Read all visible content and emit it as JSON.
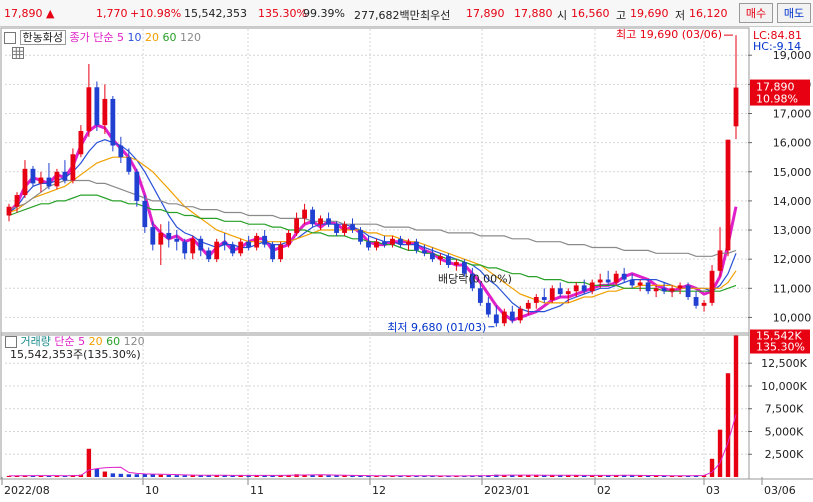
{
  "topbar": {
    "price": "17,890",
    "change_arrow": "▲",
    "change": "1,770",
    "change_pct": "+10.98%",
    "volume": "15,542,353",
    "volume_ratio": "135.30%",
    "strength": "99.39%",
    "trade_value": "277,682백만",
    "best_quote_label": "최우선",
    "best_ask": "17,890",
    "best_bid": "17,880",
    "open_label": "시",
    "open": "16,560",
    "high_label": "고",
    "high": "19,690",
    "low_label": "저",
    "low": "16,120",
    "buy_label": "매수",
    "sell_label": "매도"
  },
  "price_panel": {
    "stock_name": "한농화성",
    "ma_label": "종가 단순",
    "ma_periods": [
      "5",
      "10",
      "20",
      "60",
      "120"
    ],
    "ma_colors": [
      "#e020c8",
      "#2850d8",
      "#f0a000",
      "#28a028",
      "#8a8a8a"
    ],
    "high_annotation": "최고 19,690 (03/06)",
    "low_annotation": "최저 9,680 (01/03)",
    "mid_annotation": "배당락(0.00%)",
    "lc_label": "LC:84.81",
    "hc_label": "HC:-9.14",
    "current_price_tag": "17,890",
    "current_pct_tag": "10.98%",
    "y_ticks": [
      "19,000",
      "18,000",
      "17,000",
      "16,000",
      "15,000",
      "14,000",
      "13,000",
      "12,000",
      "11,000",
      "10,000"
    ]
  },
  "volume_panel": {
    "label": "거래량",
    "ma_label": "단순",
    "ma_periods": [
      "5",
      "20",
      "60",
      "120"
    ],
    "ma_colors": [
      "#e020c8",
      "#f0a000",
      "#28a028",
      "#8a8a8a"
    ],
    "volume_text": "15,542,353주(135.30%)",
    "current_volume_tag": "15,542K",
    "current_ratio_tag": "135.30%",
    "y_ticks": [
      "12,500K",
      "10,000K",
      "7,500K",
      "5,000K",
      "2,500K"
    ]
  },
  "x_axis": {
    "labels": [
      "2022/08",
      "10",
      "11",
      "12",
      "2023/01",
      "02",
      "03",
      "03/06"
    ]
  },
  "chart_data": {
    "type": "candlestick",
    "price_ylim": [
      9500,
      19900
    ],
    "volume_ylim": [
      0,
      15600
    ],
    "annotations": [
      {
        "text": "최고 19,690 (03/06)",
        "value": 19690
      },
      {
        "text": "최저 9,680 (01/03)",
        "value": 9680
      },
      {
        "text": "배당락(0.00%)",
        "value": 11200
      }
    ],
    "series": [
      {
        "name": "5",
        "values": [
          13600,
          13900,
          14500,
          14800,
          14700,
          14600,
          14900,
          14800,
          15200,
          15900,
          16400,
          16600,
          16500,
          16100,
          15800,
          15500,
          15000,
          14200,
          13200,
          12900,
          12700,
          12800,
          12600,
          12700,
          12400,
          12100,
          12400,
          12600,
          12300,
          12400,
          12600,
          12700,
          12700,
          12300,
          12400,
          12500,
          12900,
          13200,
          13300,
          13100,
          13300,
          13200,
          13000,
          13100,
          12900,
          12600,
          12500,
          12500,
          12600,
          12600,
          12600,
          12500,
          12300,
          12200,
          12000,
          11900,
          11800,
          11800,
          11500,
          11200,
          10800,
          10400,
          10100,
          9900,
          10000,
          10100,
          10200,
          10400,
          10600,
          10700,
          10700,
          10800,
          10900,
          11000,
          11100,
          11100,
          11200,
          11400,
          11500,
          11400,
          11300,
          11100,
          11000,
          10900,
          11000,
          11100,
          11000,
          10800,
          10900,
          11400,
          12500,
          13800
        ]
      },
      {
        "name": "10",
        "values": [
          13600,
          13800,
          14200,
          14500,
          14600,
          14600,
          14700,
          14800,
          15000,
          15300,
          15700,
          16000,
          16100,
          16000,
          15900,
          15700,
          15400,
          15000,
          14500,
          14000,
          13500,
          13100,
          12900,
          12800,
          12600,
          12500,
          12400,
          12500,
          12500,
          12400,
          12400,
          12500,
          12600,
          12500,
          12500,
          12600,
          12700,
          12900,
          13100,
          13200,
          13200,
          13200,
          13200,
          13100,
          13000,
          12800,
          12700,
          12600,
          12600,
          12500,
          12500,
          12500,
          12400,
          12300,
          12200,
          12100,
          12000,
          11900,
          11800,
          11600,
          11300,
          11100,
          10800,
          10500,
          10300,
          10200,
          10200,
          10200,
          10300,
          10400,
          10600,
          10700,
          10800,
          10900,
          11000,
          11000,
          11100,
          11200,
          11300,
          11300,
          11300,
          11300,
          11200,
          11100,
          11000,
          11000,
          11000,
          11000,
          10900,
          11100,
          11500,
          12200
        ]
      },
      {
        "name": "20",
        "values": [
          13600,
          13700,
          13900,
          14100,
          14200,
          14300,
          14400,
          14500,
          14700,
          14900,
          15100,
          15300,
          15400,
          15500,
          15500,
          15500,
          15400,
          15200,
          15000,
          14700,
          14400,
          14100,
          13800,
          13600,
          13400,
          13200,
          13000,
          12900,
          12800,
          12700,
          12600,
          12600,
          12600,
          12600,
          12600,
          12600,
          12700,
          12800,
          12900,
          13000,
          13000,
          13000,
          13000,
          13000,
          13000,
          12900,
          12900,
          12800,
          12800,
          12700,
          12600,
          12600,
          12500,
          12400,
          12300,
          12200,
          12100,
          12000,
          11900,
          11800,
          11600,
          11400,
          11200,
          11000,
          10800,
          10700,
          10600,
          10500,
          10500,
          10500,
          10500,
          10600,
          10700,
          10700,
          10800,
          10900,
          10900,
          11000,
          11000,
          11100,
          11100,
          11100,
          11100,
          11100,
          11000,
          11000,
          11000,
          11000,
          11000,
          11000,
          11200,
          11600
        ]
      },
      {
        "name": "60",
        "values": [
          13500,
          13600,
          13700,
          13800,
          13900,
          13900,
          14000,
          14000,
          14100,
          14200,
          14200,
          14200,
          14100,
          14000,
          14000,
          13900,
          13900,
          13800,
          13700,
          13700,
          13600,
          13600,
          13500,
          13500,
          13400,
          13400,
          13400,
          13300,
          13300,
          13300,
          13200,
          13200,
          13200,
          13100,
          13100,
          13000,
          13000,
          13000,
          12900,
          12900,
          12800,
          12800,
          12800,
          12700,
          12700,
          12600,
          12600,
          12500,
          12500,
          12400,
          12300,
          12300,
          12200,
          12200,
          12100,
          12000,
          12000,
          11900,
          11800,
          11800,
          11700,
          11700,
          11600,
          11500,
          11500,
          11400,
          11400,
          11300,
          11300,
          11300,
          11200,
          11200,
          11200,
          11100,
          11100,
          11100,
          11100,
          11000,
          11000,
          11000,
          11000,
          11000,
          10900,
          10900,
          10900,
          10900,
          10900,
          10900,
          10900,
          10900,
          11000,
          11100
        ]
      },
      {
        "name": "120",
        "values": [
          13700,
          13800,
          13900,
          14100,
          14300,
          14500,
          14600,
          14700,
          14700,
          14700,
          14700,
          14600,
          14600,
          14500,
          14400,
          14300,
          14200,
          14100,
          14000,
          14000,
          13900,
          13900,
          13800,
          13800,
          13700,
          13700,
          13700,
          13600,
          13600,
          13600,
          13500,
          13500,
          13500,
          13500,
          13400,
          13400,
          13400,
          13400,
          13300,
          13300,
          13300,
          13300,
          13200,
          13200,
          13200,
          13200,
          13200,
          13100,
          13100,
          13100,
          13100,
          13000,
          13000,
          13000,
          13000,
          12900,
          12900,
          12900,
          12900,
          12800,
          12800,
          12800,
          12800,
          12700,
          12700,
          12700,
          12600,
          12600,
          12600,
          12600,
          12500,
          12500,
          12500,
          12400,
          12400,
          12400,
          12400,
          12300,
          12300,
          12300,
          12300,
          12200,
          12200,
          12200,
          12200,
          12200,
          12100,
          12100,
          12100,
          12200,
          12200,
          12300
        ]
      }
    ],
    "candles": [
      [
        13500,
        13900,
        13300,
        13800
      ],
      [
        13800,
        14300,
        13600,
        14200
      ],
      [
        14200,
        15400,
        14100,
        15100
      ],
      [
        15100,
        15200,
        14500,
        14600
      ],
      [
        14600,
        15000,
        14300,
        14800
      ],
      [
        14800,
        15300,
        14400,
        14500
      ],
      [
        14500,
        15100,
        14400,
        15000
      ],
      [
        15000,
        15400,
        14600,
        14700
      ],
      [
        14700,
        15800,
        14600,
        15600
      ],
      [
        15600,
        16600,
        15500,
        16400
      ],
      [
        16400,
        18700,
        16200,
        17900
      ],
      [
        17900,
        18100,
        16400,
        16600
      ],
      [
        16600,
        18000,
        16300,
        17500
      ],
      [
        17500,
        17600,
        15700,
        15900
      ],
      [
        15900,
        16200,
        15300,
        15500
      ],
      [
        15500,
        15800,
        14900,
        15000
      ],
      [
        15000,
        15100,
        13800,
        14000
      ],
      [
        14000,
        14200,
        12900,
        13100
      ],
      [
        13100,
        13300,
        12300,
        12500
      ],
      [
        12500,
        13200,
        11800,
        12900
      ],
      [
        12900,
        13300,
        12400,
        12700
      ],
      [
        12700,
        13000,
        12300,
        12600
      ],
      [
        12600,
        12700,
        12000,
        12200
      ],
      [
        12200,
        12800,
        12000,
        12700
      ],
      [
        12700,
        12800,
        12100,
        12300
      ],
      [
        12300,
        12400,
        11900,
        12000
      ],
      [
        12000,
        12700,
        11900,
        12600
      ],
      [
        12600,
        12900,
        12300,
        12500
      ],
      [
        12500,
        12600,
        12100,
        12200
      ],
      [
        12200,
        12700,
        12100,
        12600
      ],
      [
        12600,
        12800,
        12300,
        12400
      ],
      [
        12400,
        12900,
        12300,
        12800
      ],
      [
        12800,
        13000,
        12400,
        12500
      ],
      [
        12500,
        12600,
        11900,
        12000
      ],
      [
        12000,
        12600,
        11900,
        12500
      ],
      [
        12500,
        13000,
        12400,
        12900
      ],
      [
        12900,
        13600,
        12800,
        13400
      ],
      [
        13400,
        13900,
        13200,
        13700
      ],
      [
        13700,
        13800,
        13100,
        13200
      ],
      [
        13200,
        13500,
        13000,
        13400
      ],
      [
        13400,
        13600,
        13100,
        13200
      ],
      [
        13200,
        13300,
        12800,
        12900
      ],
      [
        12900,
        13300,
        12800,
        13200
      ],
      [
        13200,
        13400,
        12900,
        13000
      ],
      [
        13000,
        13100,
        12500,
        12600
      ],
      [
        12600,
        12800,
        12300,
        12400
      ],
      [
        12400,
        12700,
        12300,
        12600
      ],
      [
        12600,
        12800,
        12400,
        12500
      ],
      [
        12500,
        12800,
        12400,
        12700
      ],
      [
        12700,
        12800,
        12400,
        12500
      ],
      [
        12500,
        12700,
        12300,
        12600
      ],
      [
        12600,
        12700,
        12200,
        12300
      ],
      [
        12300,
        12500,
        12100,
        12200
      ],
      [
        12200,
        12400,
        11900,
        12000
      ],
      [
        12000,
        12200,
        11800,
        12100
      ],
      [
        12100,
        12200,
        11700,
        11800
      ],
      [
        11800,
        12000,
        11600,
        11900
      ],
      [
        11900,
        12000,
        11400,
        11500
      ],
      [
        11500,
        11700,
        10900,
        11000
      ],
      [
        11000,
        11200,
        10400,
        10500
      ],
      [
        10500,
        10700,
        10000,
        10100
      ],
      [
        10100,
        10400,
        9680,
        9800
      ],
      [
        9800,
        10300,
        9700,
        10200
      ],
      [
        10200,
        10400,
        9800,
        9900
      ],
      [
        9900,
        10400,
        9800,
        10300
      ],
      [
        10300,
        10600,
        10100,
        10500
      ],
      [
        10500,
        10800,
        10300,
        10700
      ],
      [
        10700,
        11000,
        10500,
        10600
      ],
      [
        10600,
        11100,
        10500,
        11000
      ],
      [
        11000,
        11200,
        10700,
        10800
      ],
      [
        10800,
        11000,
        10500,
        10900
      ],
      [
        10900,
        11200,
        10700,
        11100
      ],
      [
        11100,
        11300,
        10800,
        10900
      ],
      [
        10900,
        11300,
        10800,
        11200
      ],
      [
        11200,
        11500,
        11000,
        11300
      ],
      [
        11300,
        11600,
        11100,
        11200
      ],
      [
        11200,
        11600,
        11100,
        11500
      ],
      [
        11500,
        11700,
        11200,
        11300
      ],
      [
        11300,
        11500,
        11000,
        11100
      ],
      [
        11100,
        11300,
        10900,
        11200
      ],
      [
        11200,
        11300,
        10800,
        10900
      ],
      [
        10900,
        11100,
        10700,
        11000
      ],
      [
        11000,
        11200,
        10800,
        10900
      ],
      [
        10900,
        11100,
        10700,
        11000
      ],
      [
        11000,
        11200,
        10800,
        11100
      ],
      [
        11100,
        11200,
        10600,
        10700
      ],
      [
        10700,
        10900,
        10300,
        10400
      ],
      [
        10400,
        10600,
        10200,
        10500
      ],
      [
        10500,
        11800,
        10400,
        11600
      ],
      [
        11600,
        13100,
        11400,
        12300
      ],
      [
        12300,
        16100,
        12100,
        16100
      ],
      [
        16560,
        19690,
        16120,
        17890
      ]
    ],
    "volume": [
      120,
      140,
      180,
      160,
      150,
      140,
      130,
      150,
      200,
      250,
      3100,
      900,
      600,
      400,
      350,
      300,
      300,
      350,
      300,
      250,
      220,
      200,
      180,
      200,
      180,
      170,
      200,
      180,
      160,
      170,
      180,
      200,
      180,
      160,
      170,
      220,
      300,
      260,
      220,
      200,
      180,
      170,
      160,
      150,
      150,
      140,
      130,
      140,
      150,
      140,
      130,
      130,
      120,
      120,
      130,
      120,
      120,
      130,
      150,
      180,
      200,
      250,
      220,
      180,
      200,
      220,
      200,
      180,
      190,
      200,
      180,
      170,
      160,
      170,
      180,
      200,
      190,
      180,
      170,
      160,
      150,
      150,
      140,
      140,
      150,
      160,
      170,
      180,
      2000,
      5200,
      11400,
      15542
    ]
  }
}
